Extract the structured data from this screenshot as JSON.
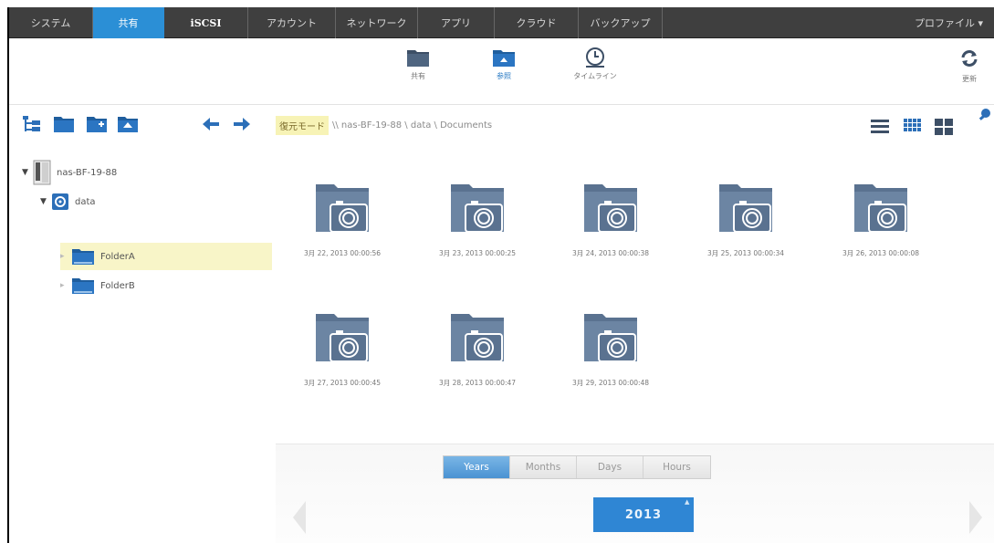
{
  "nav": {
    "tabs": [
      {
        "label": "システム",
        "active": false
      },
      {
        "label": "共有",
        "active": true
      },
      {
        "label": "iSCSI",
        "active": false
      },
      {
        "label": "アカウント",
        "active": false
      },
      {
        "label": "ネットワーク",
        "active": false
      },
      {
        "label": "アプリ",
        "active": false
      },
      {
        "label": "クラウド",
        "active": false
      },
      {
        "label": "バックアップ",
        "active": false
      }
    ],
    "profile_label": "プロファイル ▾"
  },
  "modes": {
    "share_label": "共有",
    "browse_label": "参照",
    "timeline_label": "タイムライン",
    "refresh_label": "更新"
  },
  "path": {
    "mode_badge": "復元モード",
    "location": "\\\\ nas-BF-19-88 \\ data \\ Documents"
  },
  "tree": {
    "device": "nas-BF-19-88",
    "volume": "data",
    "folders": [
      "FolderA",
      "FolderB"
    ]
  },
  "snapshots": [
    "3月 22, 2013 00:00:56",
    "3月 23, 2013 00:00:25",
    "3月 24, 2013 00:00:38",
    "3月 25, 2013 00:00:34",
    "3月 26, 2013 00:00:08",
    "3月 27, 2013 00:00:45",
    "3月 28, 2013 00:00:47",
    "3月 29, 2013 00:00:48"
  ],
  "timeline": {
    "segments": [
      {
        "label": "Years",
        "active": true
      },
      {
        "label": "Months",
        "active": false
      },
      {
        "label": "Days",
        "active": false
      },
      {
        "label": "Hours",
        "active": false
      }
    ],
    "selected_year": "2013"
  },
  "colors": {
    "nav_bg": "#3f3f3f",
    "accent": "#2b8fd6",
    "icon_blue": "#2c6fb8",
    "folder_slate": "#5a7290",
    "restore_badge_bg": "#f7f3b6"
  }
}
